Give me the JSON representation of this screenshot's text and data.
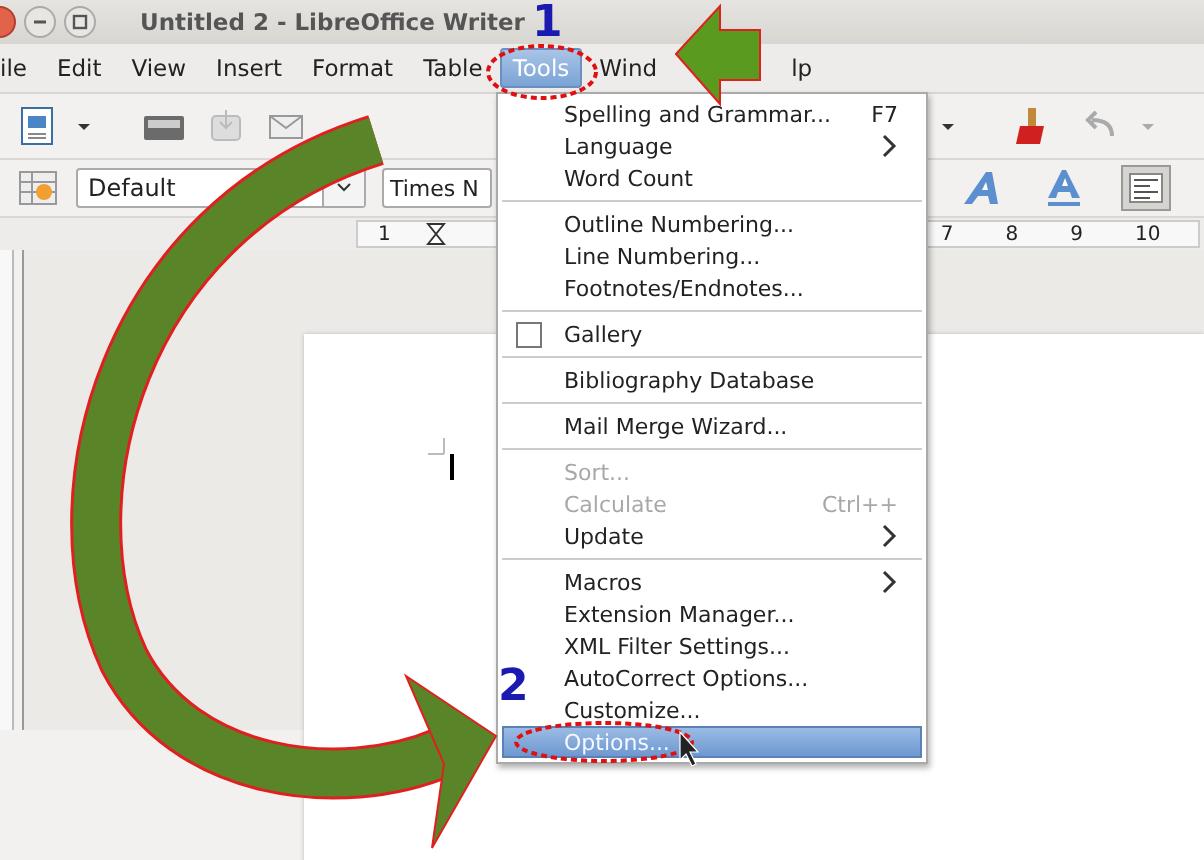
{
  "window": {
    "title": "Untitled 2 - LibreOffice Writer"
  },
  "menu_bar": [
    {
      "label": "ile",
      "selected": false
    },
    {
      "label": "Edit",
      "selected": false
    },
    {
      "label": "View",
      "selected": false
    },
    {
      "label": "Insert",
      "selected": false
    },
    {
      "label": "Format",
      "selected": false
    },
    {
      "label": "Table",
      "selected": false
    },
    {
      "label": "Tools",
      "selected": true
    },
    {
      "label": "Wind",
      "selected": false
    },
    {
      "label": "lp",
      "selected": false
    }
  ],
  "formatting_bar": {
    "style_box": {
      "value": "Default"
    },
    "font_box": {
      "value": "Times N"
    }
  },
  "ruler": {
    "left_marks": [
      "1"
    ],
    "right_marks": [
      "7",
      "8",
      "9",
      "10"
    ]
  },
  "tools_menu": {
    "groups": [
      [
        {
          "kind": "command",
          "label": "Spelling and Grammar...",
          "shortcut": "F7",
          "submenu": false,
          "disabled": false,
          "selected": false
        },
        {
          "kind": "command",
          "label": "Language",
          "submenu": true,
          "disabled": false,
          "selected": false
        },
        {
          "kind": "command",
          "label": "Word Count",
          "submenu": false,
          "disabled": false,
          "selected": false
        }
      ],
      [
        {
          "kind": "command",
          "label": "Outline Numbering...",
          "submenu": false,
          "disabled": false,
          "selected": false
        },
        {
          "kind": "command",
          "label": "Line Numbering...",
          "submenu": false,
          "disabled": false,
          "selected": false
        },
        {
          "kind": "command",
          "label": "Footnotes/Endnotes...",
          "submenu": false,
          "disabled": false,
          "selected": false
        }
      ],
      [
        {
          "kind": "checkbox",
          "label": "Gallery",
          "checked": false,
          "submenu": false,
          "disabled": false,
          "selected": false
        }
      ],
      [
        {
          "kind": "command",
          "label": "Bibliography Database",
          "submenu": false,
          "disabled": false,
          "selected": false
        }
      ],
      [
        {
          "kind": "command",
          "label": "Mail Merge Wizard...",
          "submenu": false,
          "disabled": false,
          "selected": false
        }
      ],
      [
        {
          "kind": "command",
          "label": "Sort...",
          "submenu": false,
          "disabled": true,
          "selected": false
        },
        {
          "kind": "command",
          "label": "Calculate",
          "shortcut": "Ctrl++",
          "submenu": false,
          "disabled": true,
          "selected": false
        },
        {
          "kind": "command",
          "label": "Update",
          "submenu": true,
          "disabled": false,
          "selected": false
        }
      ],
      [
        {
          "kind": "command",
          "label": "Macros",
          "submenu": true,
          "disabled": false,
          "selected": false
        },
        {
          "kind": "command",
          "label": "Extension Manager...",
          "submenu": false,
          "disabled": false,
          "selected": false
        },
        {
          "kind": "command",
          "label": "XML Filter Settings...",
          "submenu": false,
          "disabled": false,
          "selected": false
        },
        {
          "kind": "command",
          "label": "AutoCorrect Options...",
          "submenu": false,
          "disabled": false,
          "selected": false
        },
        {
          "kind": "command",
          "label": "Customize...",
          "submenu": false,
          "disabled": false,
          "selected": false
        },
        {
          "kind": "command",
          "label": "Options...",
          "submenu": false,
          "disabled": false,
          "selected": true
        }
      ]
    ]
  },
  "annotations": {
    "step_1": "1",
    "step_2": "2"
  }
}
